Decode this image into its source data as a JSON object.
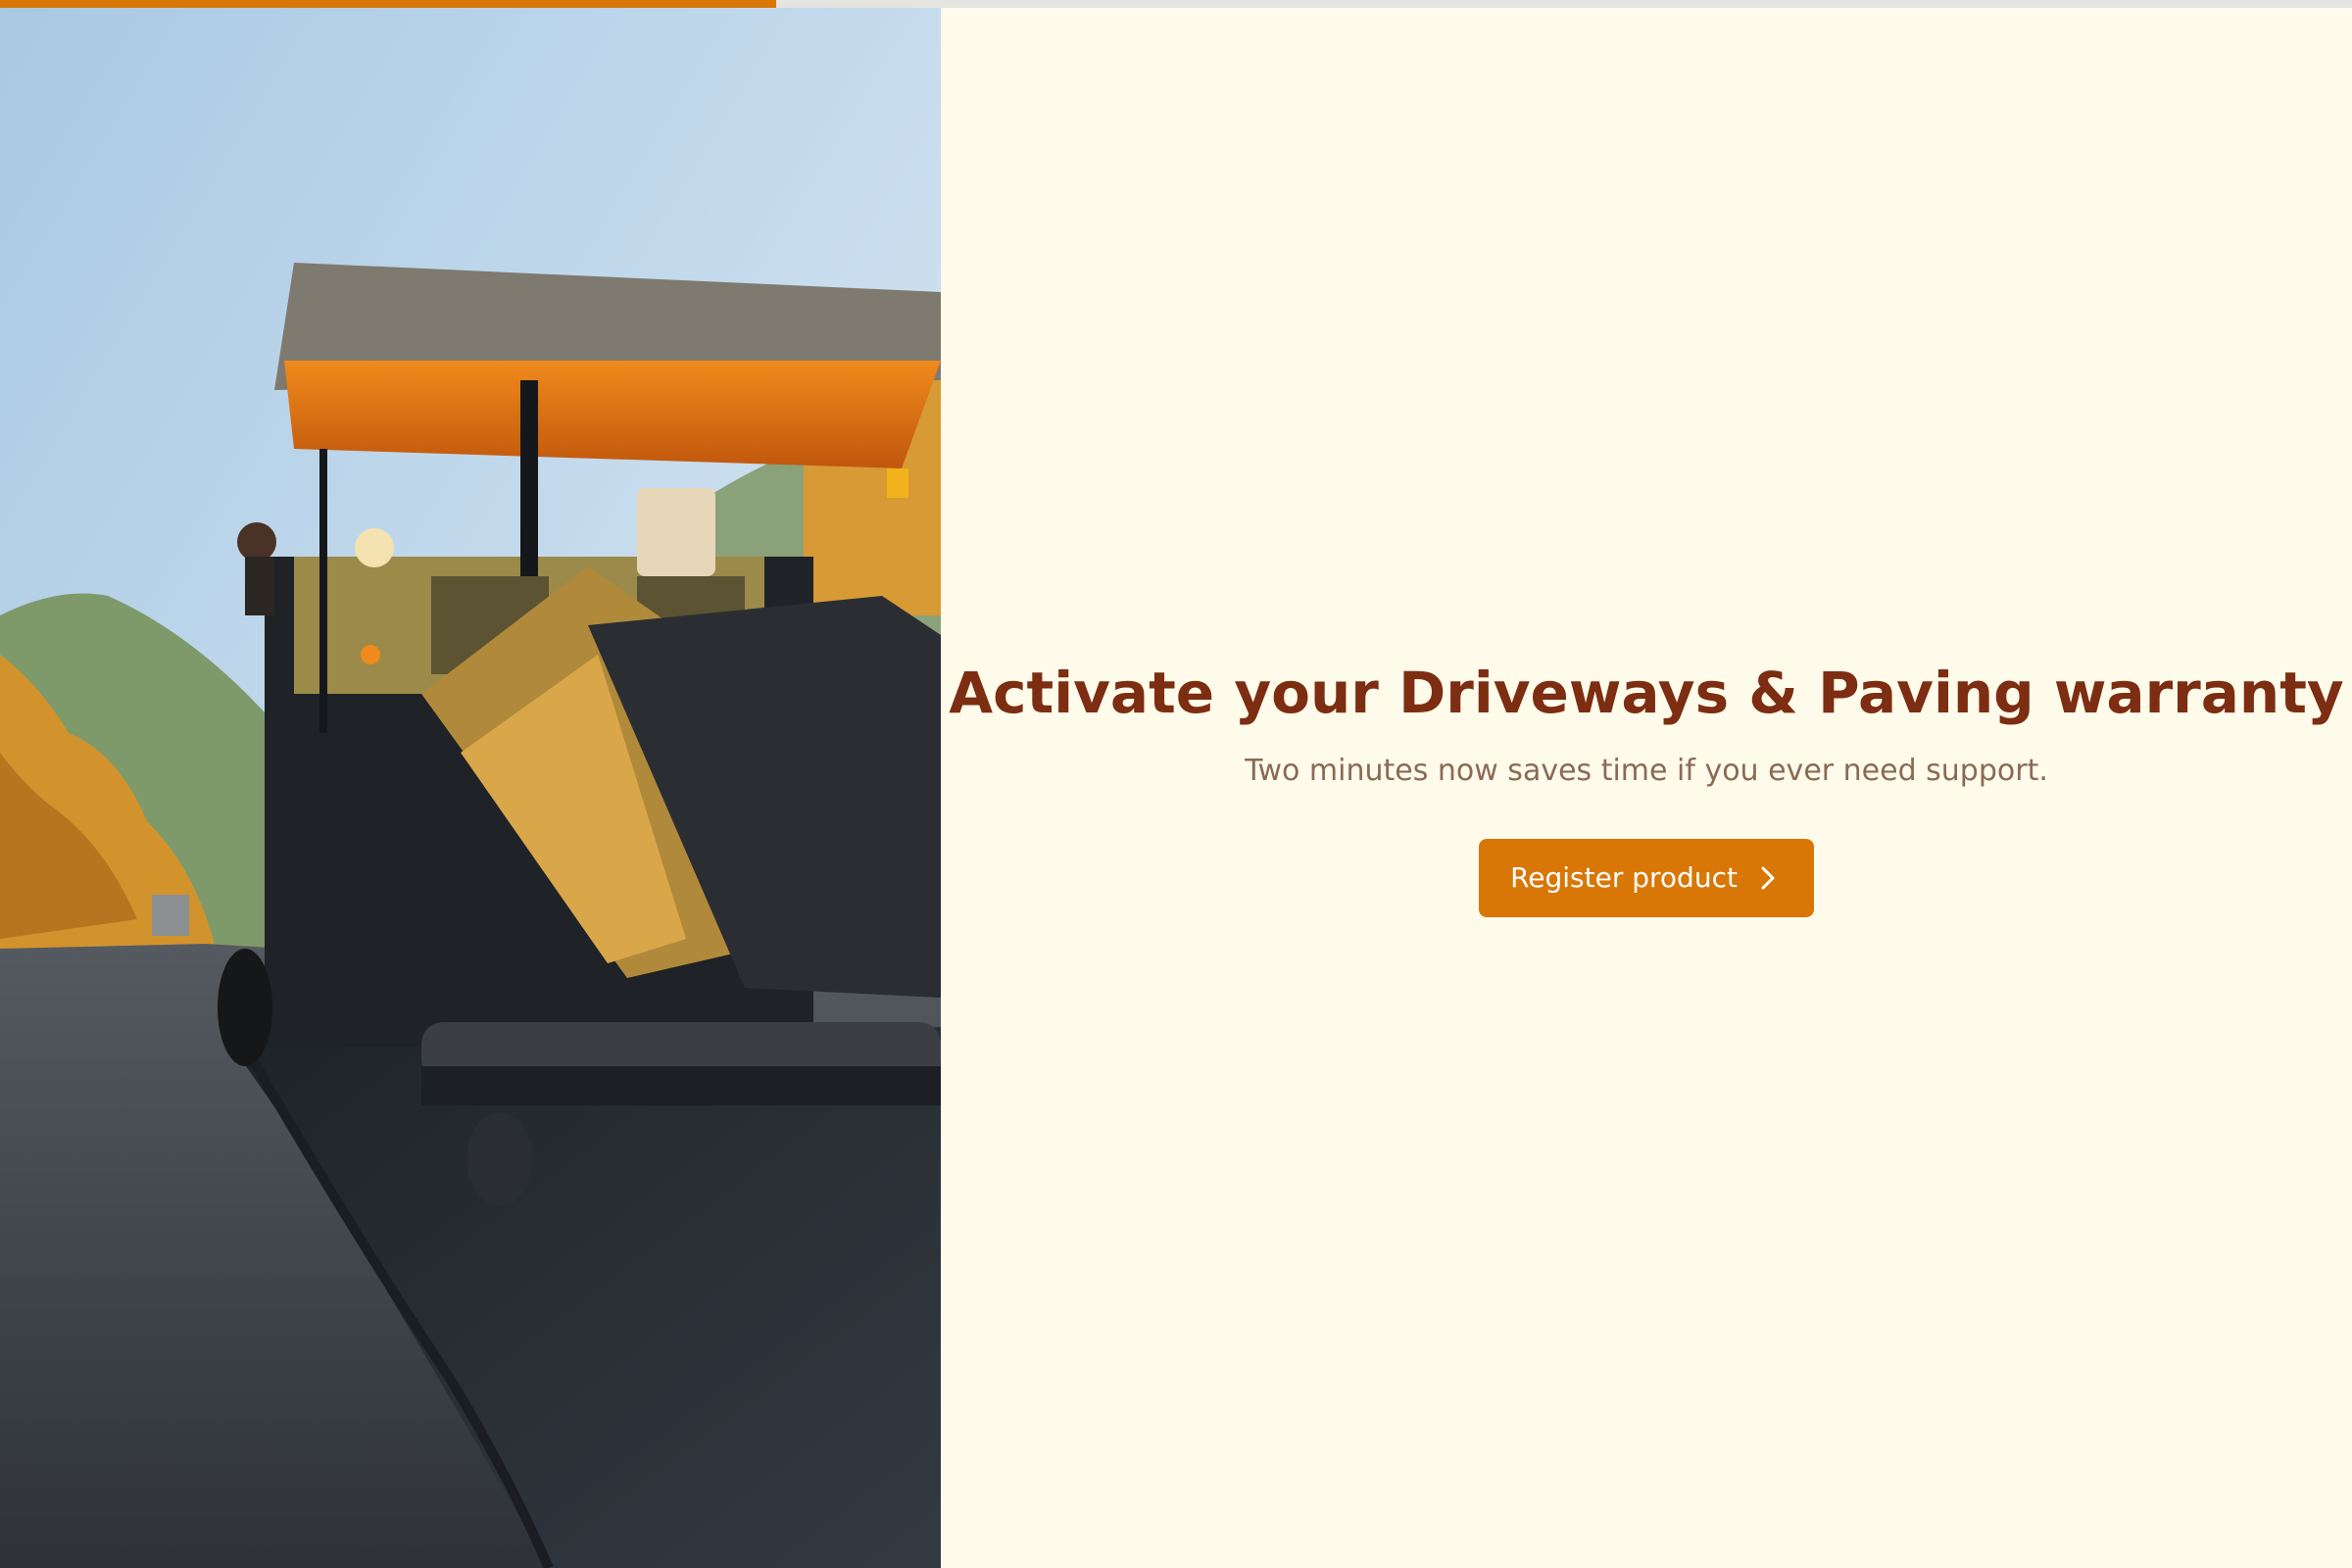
{
  "progress": {
    "fraction": 0.33,
    "fill_color": "#d97706",
    "track_color": "#e6e4e0"
  },
  "hero": {
    "image_icon": "paving-machine-photo"
  },
  "content": {
    "title": "Activate your Driveways & Paving warranty",
    "subtitle": "Two minutes now saves time if you ever need support.",
    "cta_label": "Register product",
    "cta_icon": "chevron-right-icon"
  },
  "colors": {
    "background": "#fffbea",
    "title": "#7c2d12",
    "subtitle": "#8a6a55",
    "accent": "#d97706"
  }
}
